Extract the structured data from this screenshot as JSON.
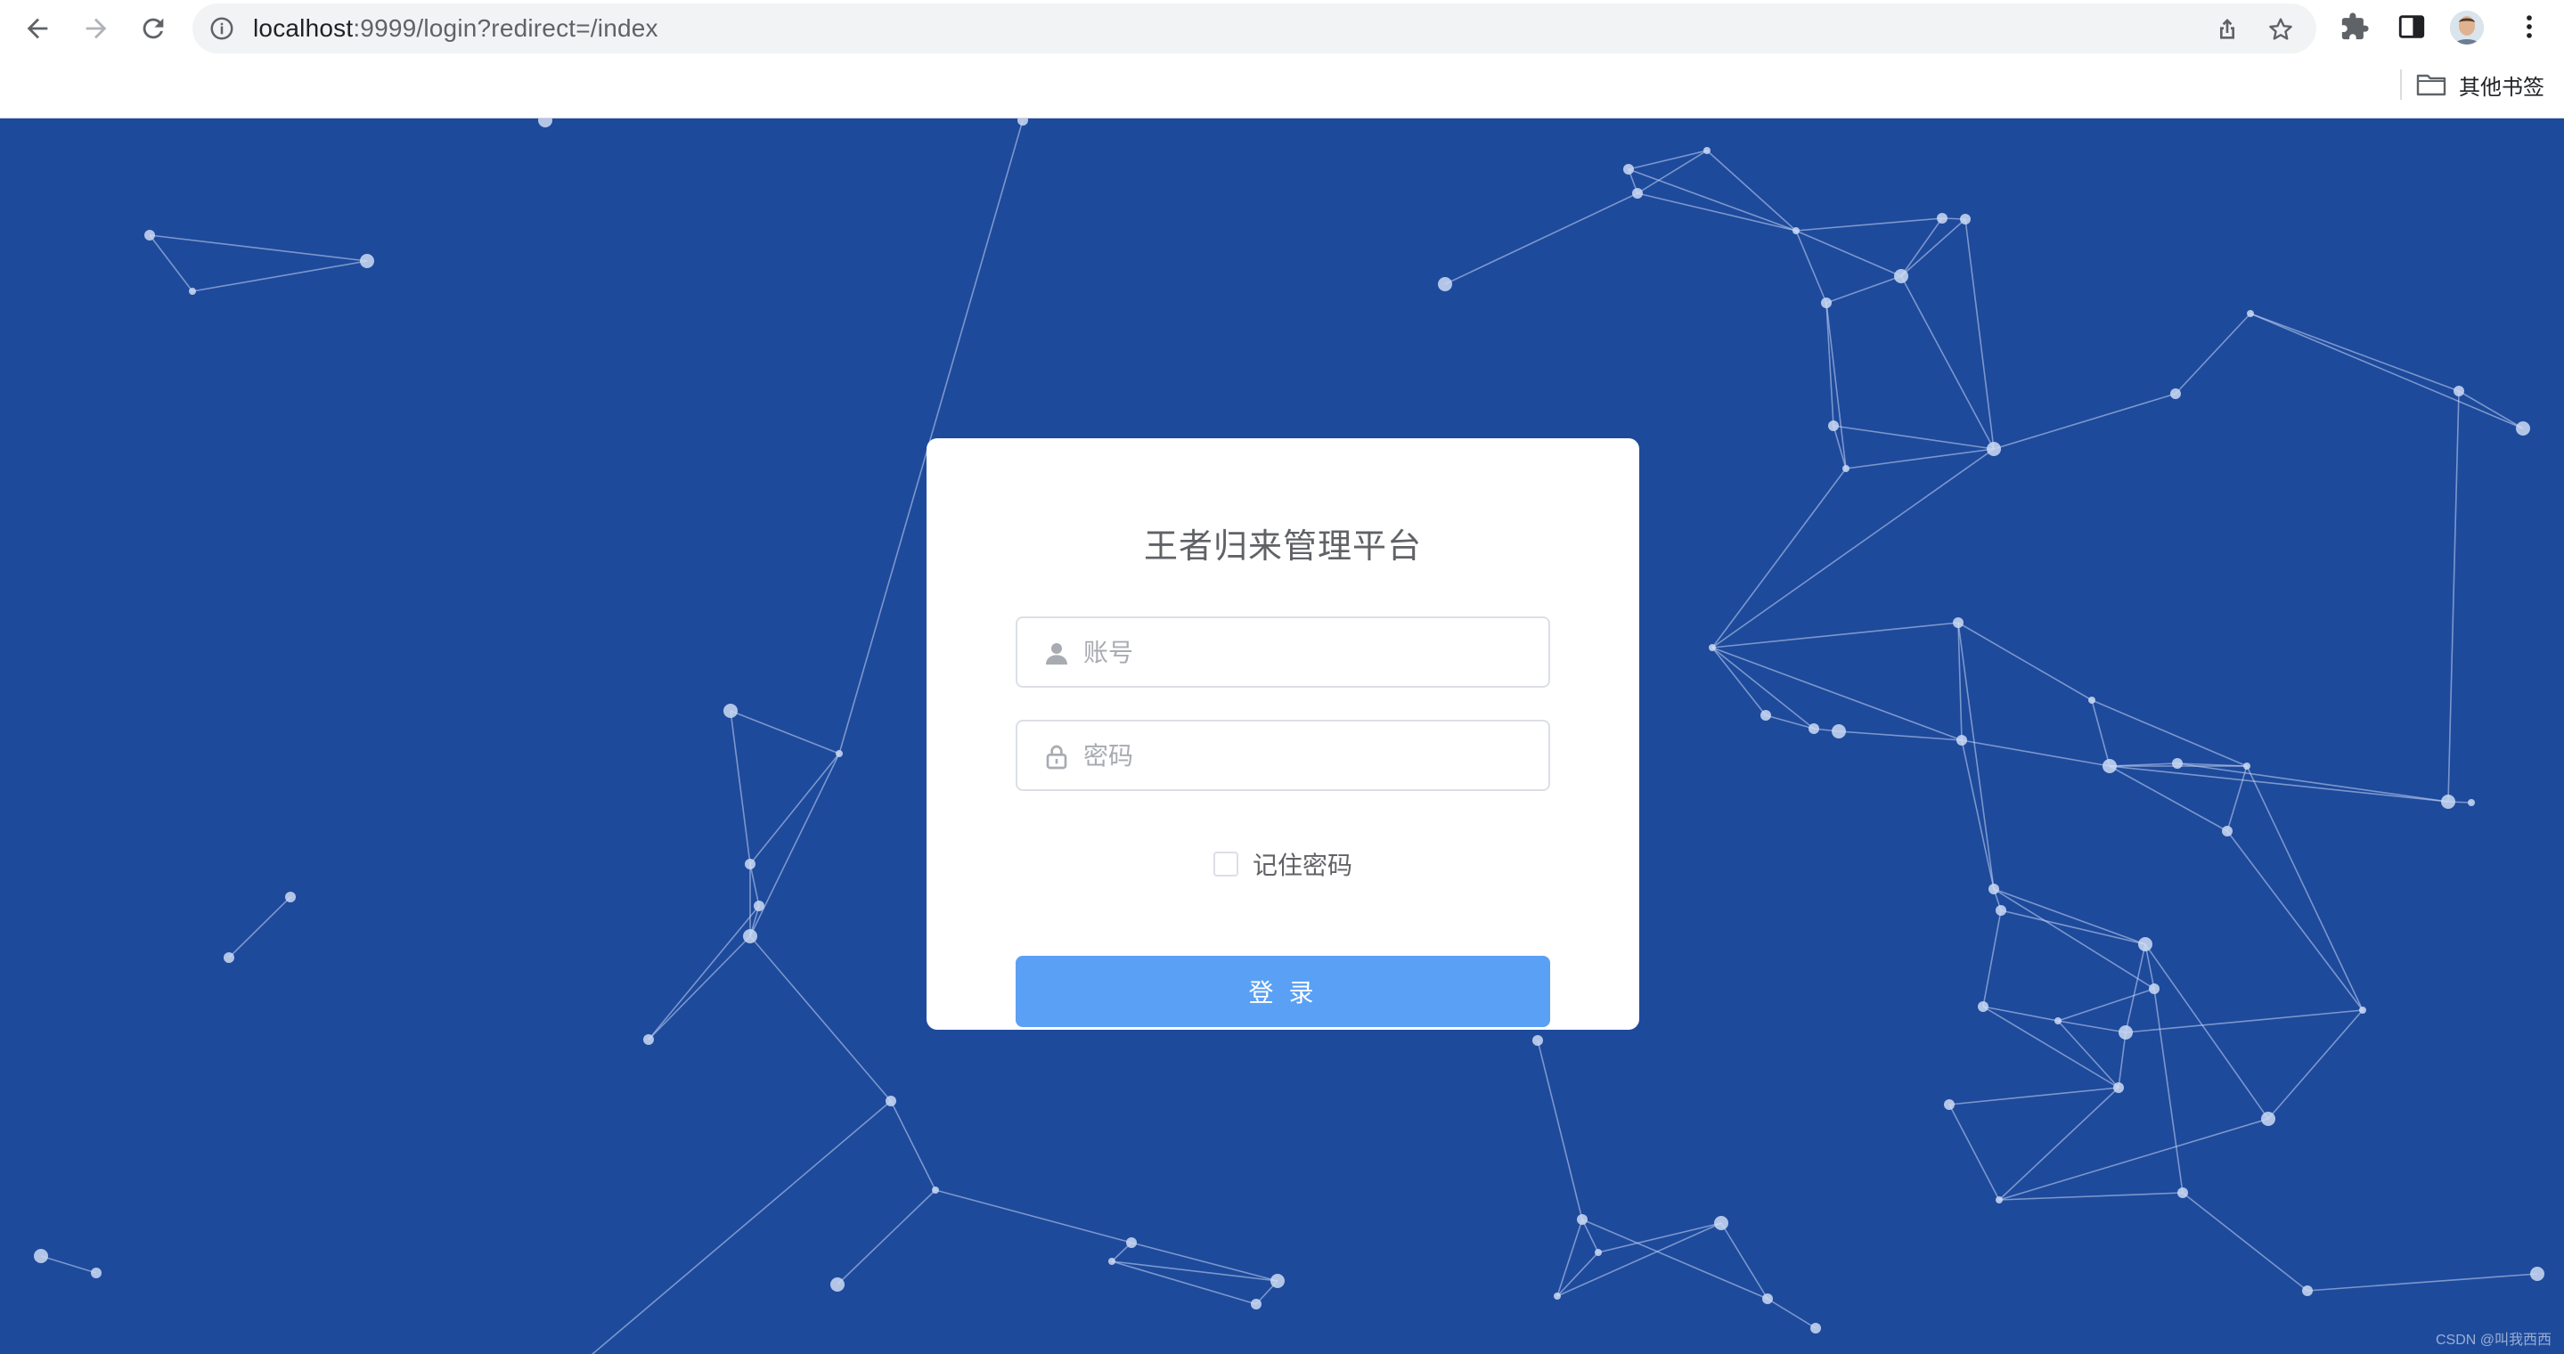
{
  "browser": {
    "url_host": "localhost",
    "url_rest": ":9999/login?redirect=/index",
    "bookmark_label": "其他书签",
    "icons": {
      "back": "arrow-left-icon",
      "forward": "arrow-right-icon",
      "reload": "reload-icon",
      "site_info": "info-icon",
      "share": "share-icon",
      "star": "star-icon",
      "extensions": "puzzle-icon",
      "side_panel": "side-panel-icon",
      "menu": "kebab-menu-icon",
      "folder": "folder-icon"
    }
  },
  "login": {
    "title": "王者归来管理平台",
    "username_placeholder": "账号",
    "password_placeholder": "密码",
    "remember_label": "记住密码",
    "submit_label": "登 录"
  },
  "watermark": "CSDN @叫我西西",
  "colors": {
    "page_background": "#1e4a9c",
    "button": "#5aa0f5",
    "title_text": "#606266"
  }
}
